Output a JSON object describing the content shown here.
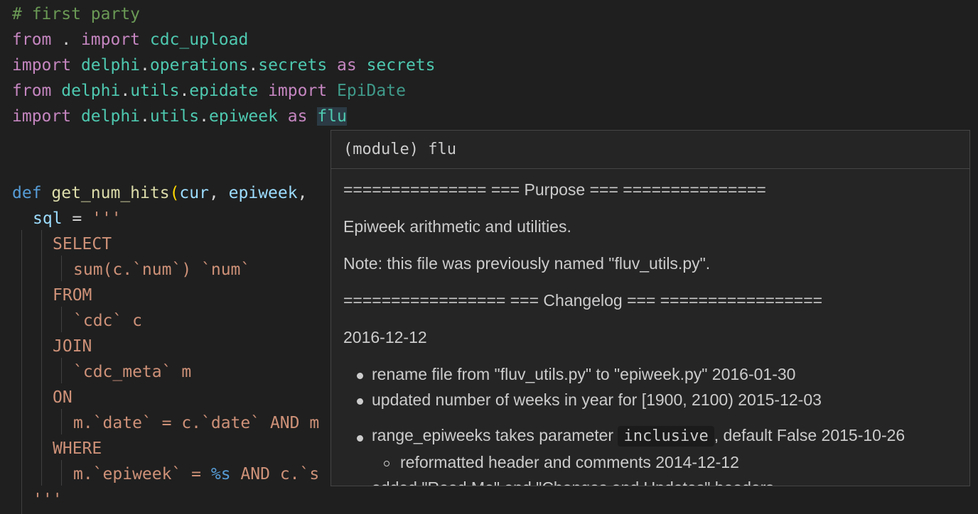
{
  "code": {
    "comment": "# first party",
    "l2": {
      "from": "from",
      "dot": " . ",
      "import": "import",
      "mod": " cdc_upload"
    },
    "l3": {
      "import": "import",
      "m1": " delphi",
      "p1": ".",
      "m2": "operations",
      "p2": ".",
      "m3": "secrets",
      "as": " as",
      "alias": " secrets"
    },
    "l4": {
      "from": "from",
      "m1": " delphi",
      "p1": ".",
      "m2": "utils",
      "p2": ".",
      "m3": "epidate",
      "import": " import",
      "cls": " EpiDate"
    },
    "l5": {
      "import": "import",
      "m1": " delphi",
      "p1": ".",
      "m2": "utils",
      "p2": ".",
      "m3": "epiweek",
      "as": " as",
      "sp": " ",
      "alias": "flu"
    },
    "l8": {
      "def": "def",
      "fn": " get_num_hits",
      "open": "(",
      "a1": "cur",
      "comma": ", ",
      "a2": "epiweek",
      "comma2": ","
    },
    "l9": {
      "var": "sql",
      "eq": " = ",
      "str": "'''"
    },
    "l10": "SELECT",
    "l11": "sum(c.`num`) `num`",
    "l12": "FROM",
    "l13": "`cdc` c",
    "l14": "JOIN",
    "l15": "`cdc_meta` m",
    "l16": "ON",
    "l17": "m.`date` = c.`date` AND m",
    "l18": "WHERE",
    "l19a": "m.`epiweek` = ",
    "l19b": "%s",
    "l19c": " AND c.`s",
    "l20": "'''"
  },
  "hover": {
    "header": "(module) flu",
    "purpose_line": "=============== === Purpose === ===============",
    "description": "Epiweek arithmetic and utilities.",
    "note": "Note: this file was previously named \"fluv_utils.py\".",
    "changelog_line": "================= === Changelog === =================",
    "date": "2016-12-12",
    "items": [
      "rename file from \"fluv_utils.py\" to \"epiweek.py\" 2016-01-30",
      "updated number of weeks in year for [1900, 2100) 2015-12-03"
    ],
    "item3_pre": "range_epiweeks takes parameter ",
    "item3_code": "inclusive",
    "item3_post": ", default False 2015-10-26",
    "subitem": "reformatted header and comments 2014-12-12",
    "cut_item": "added \"Read Me\" and \"Changes and Updates\" headers"
  }
}
